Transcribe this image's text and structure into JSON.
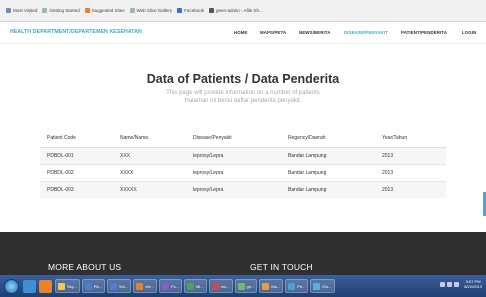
{
  "bookmarks": [
    {
      "label": "Most Visited",
      "icon": "bookmark-icon"
    },
    {
      "label": "Getting Started",
      "icon": "page-icon"
    },
    {
      "label": "Suggested Sites",
      "icon": "orange-icon"
    },
    {
      "label": "Web Slice Gallery",
      "icon": "page-icon"
    },
    {
      "label": "Facebook",
      "icon": "facebook-icon"
    },
    {
      "label": "geen-admin - Afile Sh...",
      "icon": "page-icon"
    }
  ],
  "brand": "HEALTH DEPARTMENT/DEPARTEMEN KESEHATAN",
  "nav": [
    {
      "label": "HOME"
    },
    {
      "label": "MAPS/PETA"
    },
    {
      "label": "NEWS/BERITA"
    },
    {
      "label": "DISEASE/PENYAKIT"
    },
    {
      "label": "PATIENT/PENDERITA"
    },
    {
      "label": "LOGIN"
    }
  ],
  "page": {
    "title": "Data of Patients / Data Penderita",
    "subtitle_line1": "This page will provide information on a number of patients",
    "subtitle_line2": "Halaman ini berisi daftar penderita penyakit."
  },
  "table": {
    "headers": [
      "Patient Code",
      "Name/Nama",
      "Disease/Penyakit",
      "Regency/Daerah",
      "Year/Tahun"
    ],
    "rows": [
      [
        "PDBDL-001",
        "XXX",
        "leprosy/Lepra",
        "Bandar Lampung",
        "2013"
      ],
      [
        "PDBDL-002",
        "XXXX",
        "leprosy/Lepra",
        "Bandar Lampung",
        "2013"
      ],
      [
        "PDBDL-003",
        "XXXXX",
        "leprosy/Lepra",
        "Bandar Lampung",
        "2013"
      ]
    ]
  },
  "footer": {
    "left_heading": "MORE ABOUT US",
    "right_heading": "GET IN TOUCH"
  },
  "taskbar": {
    "apps": [
      "Sky...",
      "PA...",
      "Wo...",
      "ele...",
      "Pc...",
      "Mi...",
      "mo...",
      "ge...",
      "Ma...",
      "Ph...",
      "Dis..."
    ],
    "clock_time": "3:07 PM",
    "clock_date": "8/22/2013"
  },
  "colors": {
    "accent": "#3aa6c7",
    "footer_bg": "#2f2f2f",
    "taskbar": "#2a4d86"
  }
}
